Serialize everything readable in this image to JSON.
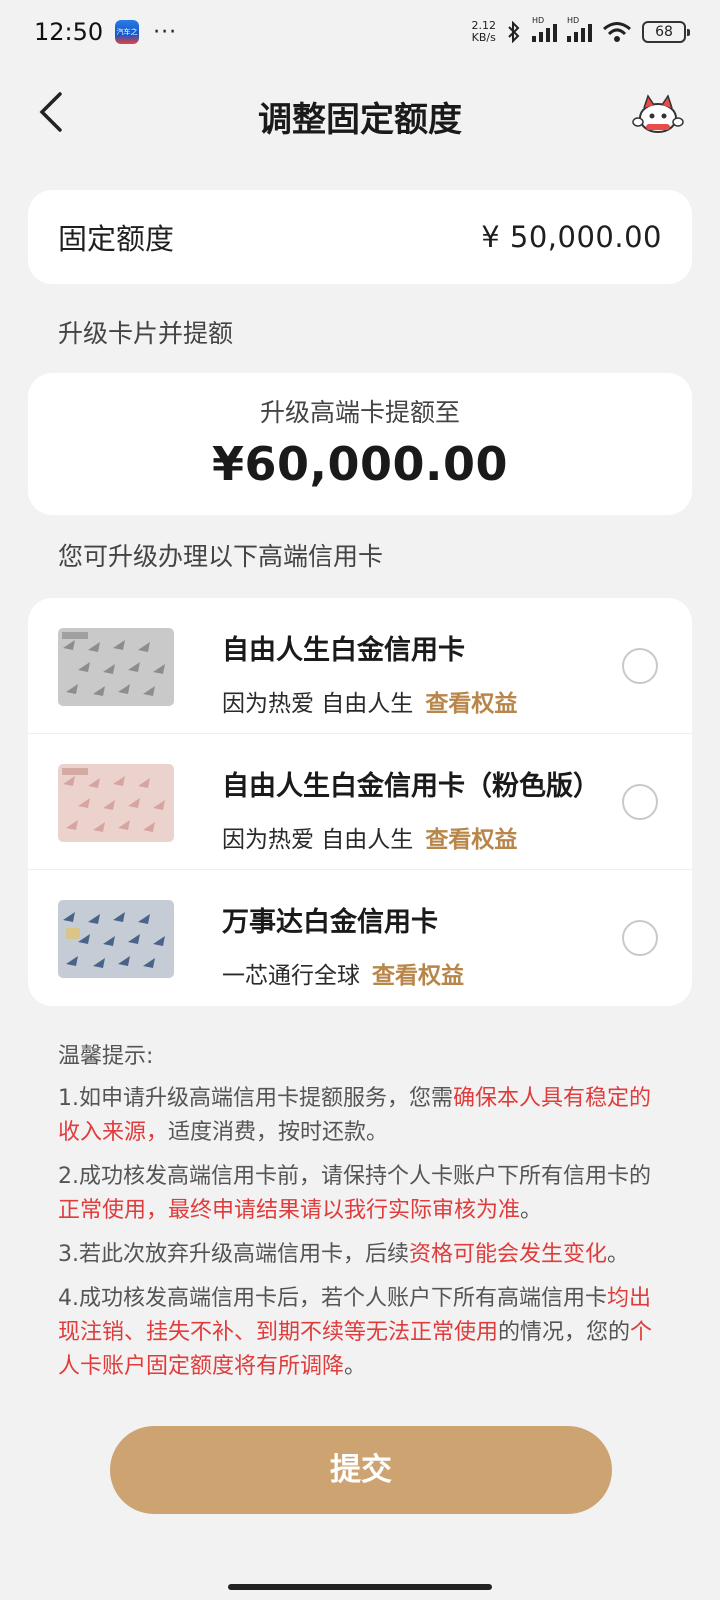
{
  "status_bar": {
    "time": "12:50",
    "app_badge_text": "汽车之家",
    "more": "···",
    "net_speed_value": "2.12",
    "net_speed_unit": "KB/s",
    "signal_label_1": "HD",
    "signal_label_2": "HD",
    "battery": "68",
    "icons": [
      "bluetooth-icon",
      "signal-icon",
      "signal-icon",
      "wifi-icon",
      "battery-icon"
    ]
  },
  "nav": {
    "title": "调整固定额度",
    "back_icon": "chevron-left-icon",
    "mascot_icon": "mascot-icon"
  },
  "fixed_limit": {
    "label": "固定额度",
    "value": "¥ 50,000.00"
  },
  "upgrade_section": {
    "label": "升级卡片并提额",
    "card_subtitle": "升级高端卡提额至",
    "card_amount": "¥60,000.00"
  },
  "cards_section": {
    "label": "您可升级办理以下高端信用卡",
    "items": [
      {
        "name": "自由人生白金信用卡",
        "desc": "因为热爱 自由人生",
        "link": "查看权益",
        "selected": false,
        "style": "silver"
      },
      {
        "name": "自由人生白金信用卡（粉色版）",
        "desc": "因为热爱 自由人生",
        "link": "查看权益",
        "selected": false,
        "style": "pink"
      },
      {
        "name": "万事达白金信用卡",
        "desc": "一芯通行全球",
        "link": "查看权益",
        "selected": false,
        "style": "blue"
      }
    ]
  },
  "tips": {
    "title": "温馨提示:",
    "t1": {
      "a": "1.如申请升级高端信用卡提额服务，您需",
      "b": "确保本人具有稳定的收入来源，",
      "c": "适度消费，按时还款。"
    },
    "t2": {
      "a": "2.成功核发高端信用卡前，请保持个人卡账户下所有信用卡的",
      "b": "正常使用，最终申请结果请以我行实际审核为准",
      "c": "。"
    },
    "t3": {
      "a": "3.若此次放弃升级高端信用卡，后续",
      "b": "资格可能会发生变化",
      "c": "。"
    },
    "t4": {
      "a": "4.成功核发高端信用卡后，若个人账户下所有高端信用卡",
      "b": "均出现注销、挂失不补、到期不续等无法正常使用",
      "c": "的情况，您的",
      "d": "个人卡账户固定额度将有所调降",
      "e": "。"
    }
  },
  "submit": {
    "label": "提交"
  },
  "colors": {
    "accent": "#cda471",
    "link": "#b8864a",
    "warning_red": "#e03c3c",
    "background": "#f2f2f2"
  }
}
